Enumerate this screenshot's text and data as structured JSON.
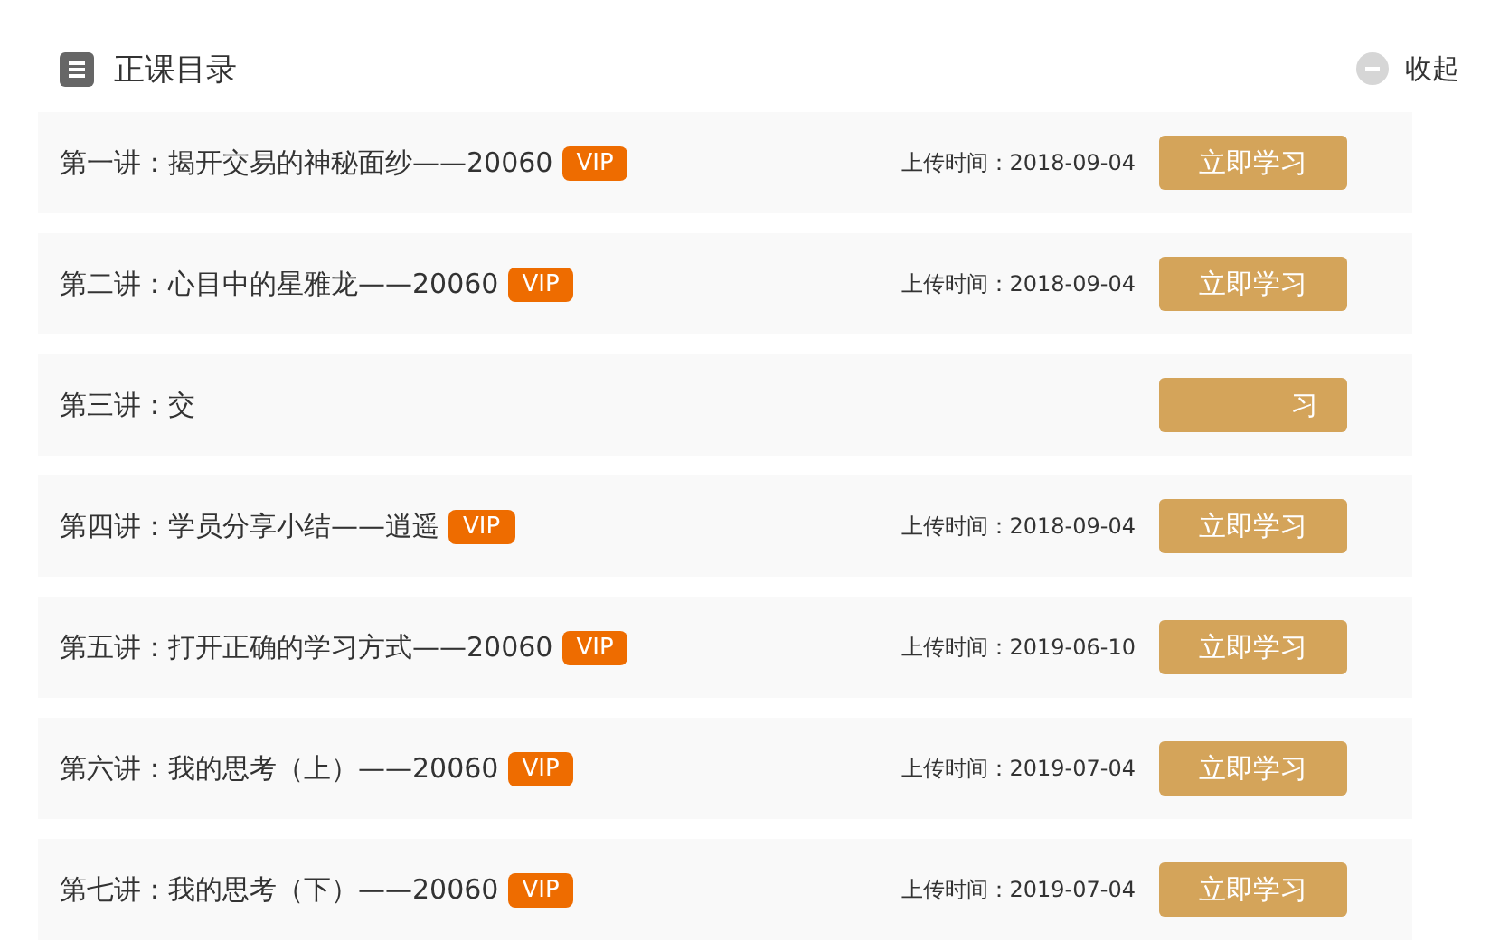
{
  "header": {
    "title": "正课目录",
    "toggle": "收起"
  },
  "lessons": [
    {
      "title": "第一讲：揭开交易的神秘面纱——20060",
      "badge": "VIP",
      "upload_time": "上传时间：2018-09-04",
      "button": "立即学习"
    },
    {
      "title": "第二讲：心目中的星雅龙——20060",
      "badge": "VIP",
      "upload_time": "上传时间：2018-09-04",
      "button": "立即学习"
    },
    {
      "title": "第三讲：交",
      "button": "习"
    },
    {
      "title": "第四讲：学员分享小结——逍遥",
      "badge": "VIP",
      "upload_time": "上传时间：2018-09-04",
      "button": "立即学习"
    },
    {
      "title": "第五讲：打开正确的学习方式——20060",
      "badge": "VIP",
      "upload_time": "上传时间：2019-06-10",
      "button": "立即学习"
    },
    {
      "title": "第六讲：我的思考（上）——20060",
      "badge": "VIP",
      "upload_time": "上传时间：2019-07-04",
      "button": "立即学习"
    },
    {
      "title": "第七讲：我的思考（下）——20060",
      "badge": "VIP",
      "upload_time": "上传时间：2019-07-04",
      "button": "立即学习"
    }
  ]
}
